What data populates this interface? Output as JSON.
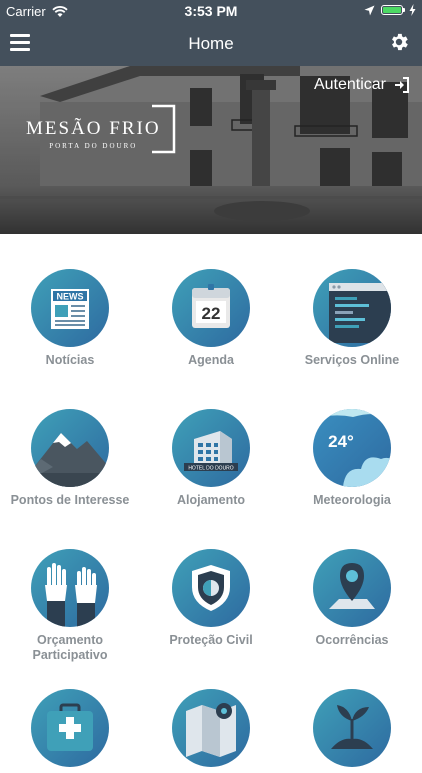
{
  "status_bar": {
    "carrier": "Carrier",
    "time": "3:53 PM",
    "battery_level": 1.0
  },
  "nav": {
    "title": "Home"
  },
  "hero": {
    "auth_label": "Autenticar",
    "brand_title": "MESÃO FRIO",
    "brand_subtitle": "PORTA DO DOURO"
  },
  "tiles": [
    {
      "label": "Notícias",
      "icon": "newspaper-icon"
    },
    {
      "label": "Agenda",
      "icon": "calendar-icon",
      "calendar_day": "22"
    },
    {
      "label": "Serviços Online",
      "icon": "browser-window-icon"
    },
    {
      "label": "Pontos de Interesse",
      "icon": "mountain-icon"
    },
    {
      "label": "Alojamento",
      "icon": "hotel-building-icon",
      "hotel_sign": "HOTEL DO DOURO"
    },
    {
      "label": "Meteorologia",
      "icon": "weather-cloud-icon",
      "temperature": "24°"
    },
    {
      "label": "Orçamento Participativo",
      "icon": "raised-hands-icon"
    },
    {
      "label": "Proteção Civil",
      "icon": "shield-icon"
    },
    {
      "label": "Ocorrências",
      "icon": "map-pin-icon"
    },
    {
      "label": "",
      "icon": "first-aid-kit-icon"
    },
    {
      "label": "",
      "icon": "map-icon"
    },
    {
      "label": "",
      "icon": "plant-icon"
    }
  ],
  "colors": {
    "bar": "#44505c",
    "tile_gradient_start": "#3fa0b8",
    "tile_gradient_end": "#2e6aa0",
    "label": "#8a9095"
  }
}
